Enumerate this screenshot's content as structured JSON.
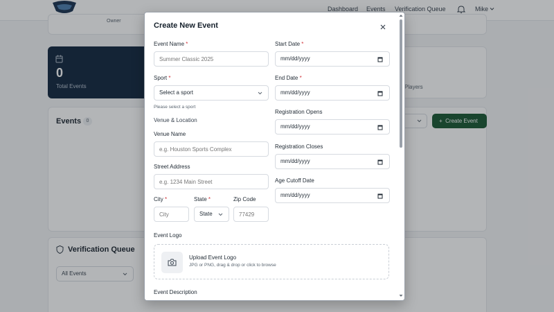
{
  "nav": {
    "links": [
      "Dashboard",
      "Events",
      "Verification Queue"
    ],
    "user": "Mike"
  },
  "background": {
    "owner_badge": "Owner",
    "stat_total_events_value": "0",
    "stat_total_events_label": "Total Events",
    "stat_players_label": "Players",
    "events_title": "Events",
    "events_count": "0",
    "create_event_button": "Create Event",
    "verification_title": "Verification Queue",
    "verification_filter": "All Events"
  },
  "modal": {
    "title": "Create New Event",
    "event_name": {
      "label": "Event Name",
      "placeholder": "Summer Classic 2025"
    },
    "sport": {
      "label": "Sport",
      "value": "Select a sport",
      "hint": "Please select a sport"
    },
    "venue_section": "Venue & Location",
    "venue_name": {
      "label": "Venue Name",
      "placeholder": "e.g. Houston Sports Complex"
    },
    "street": {
      "label": "Street Address",
      "placeholder": "e.g. 1234 Main Street"
    },
    "city": {
      "label": "City",
      "placeholder": "City"
    },
    "state": {
      "label": "State",
      "value": "State"
    },
    "zip": {
      "label": "Zip Code",
      "placeholder": "77429"
    },
    "start_date": {
      "label": "Start Date",
      "value": "mm/dd/yyyy"
    },
    "end_date": {
      "label": "End Date",
      "value": "mm/dd/yyyy"
    },
    "registration_opens": {
      "label": "Registration Opens",
      "value": "mm/dd/yyyy"
    },
    "registration_closes": {
      "label": "Registration Closes",
      "value": "mm/dd/yyyy"
    },
    "age_cutoff": {
      "label": "Age Cutoff Date",
      "value": "mm/dd/yyyy"
    },
    "logo": {
      "label": "Event Logo",
      "upload_title": "Upload Event Logo",
      "upload_sub": "JPG or PNG, drag & drop or click to browse"
    },
    "description_label": "Event Description",
    "required_mark": "*"
  },
  "colors": {
    "accent_green": "#1c5a36",
    "navy": "#152a42",
    "required": "#d0343a"
  }
}
